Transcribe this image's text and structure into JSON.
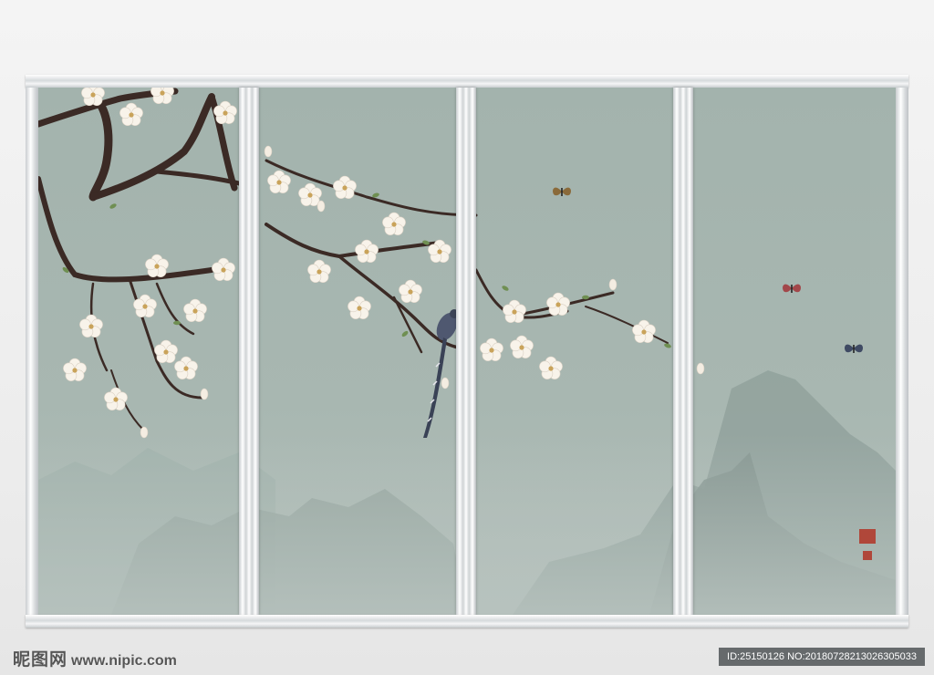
{
  "watermark": {
    "logo_text": "昵图网",
    "url": "www.nipic.com",
    "id_text": "ID:25150126 NO:20180728213026305033"
  },
  "colors": {
    "panel_bg": "#a4b4ae",
    "branch": "#3b2a25",
    "blossom": "#f7f1e8",
    "mountain": "#8f9f99",
    "seal": "#b0473a"
  },
  "artwork": {
    "panels": 4,
    "subjects": [
      "magnolia-branches",
      "long-tailed-bird",
      "butterflies",
      "misty-mountains",
      "red-seal"
    ]
  }
}
